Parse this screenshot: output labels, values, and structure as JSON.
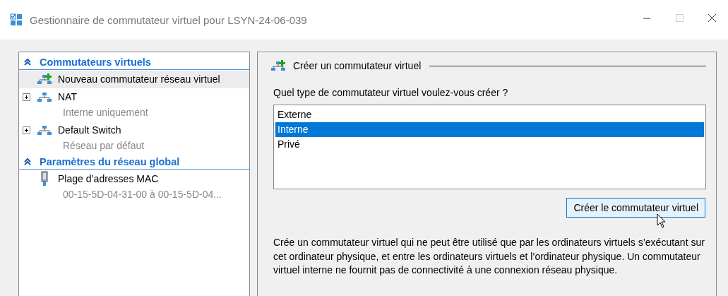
{
  "window": {
    "title": "Gestionnaire de commutateur virtuel pour LSYN-24-06-039"
  },
  "sidebar": {
    "sections": [
      {
        "title": "Commutateurs virtuels",
        "expanded": true,
        "items": [
          {
            "kind": "new",
            "label": "Nouveau commutateur réseau virtuel",
            "selected": true
          },
          {
            "kind": "switch",
            "label": "NAT",
            "detail": "Interne uniquement",
            "expanded": false,
            "selected": false
          },
          {
            "kind": "switch",
            "label": "Default Switch",
            "detail": "Réseau par défaut",
            "expanded": false,
            "selected": false
          }
        ]
      },
      {
        "title": "Paramètres du réseau global",
        "expanded": true,
        "items": [
          {
            "kind": "mac",
            "label": "Plage d’adresses MAC",
            "detail": "00-15-5D-04-31-00 à 00-15-5D-04...",
            "selected": false
          }
        ]
      }
    ]
  },
  "panel": {
    "title": "Créer un commutateur virtuel",
    "question": "Quel type de commutateur virtuel voulez-vous créer ?",
    "options": [
      {
        "label": "Externe",
        "selected": false
      },
      {
        "label": "Interne",
        "selected": true
      },
      {
        "label": "Privé",
        "selected": false
      }
    ],
    "button": "Créer le commutateur virtuel",
    "description": "Crée un commutateur virtuel qui ne peut être utilisé que par les ordinateurs virtuels s’exécutant sur cet ordinateur physique, et entre les ordinateurs virtuels et l’ordinateur physique. Un commutateur virtuel interne ne fournit pas de connectivité à une connexion réseau physique."
  }
}
